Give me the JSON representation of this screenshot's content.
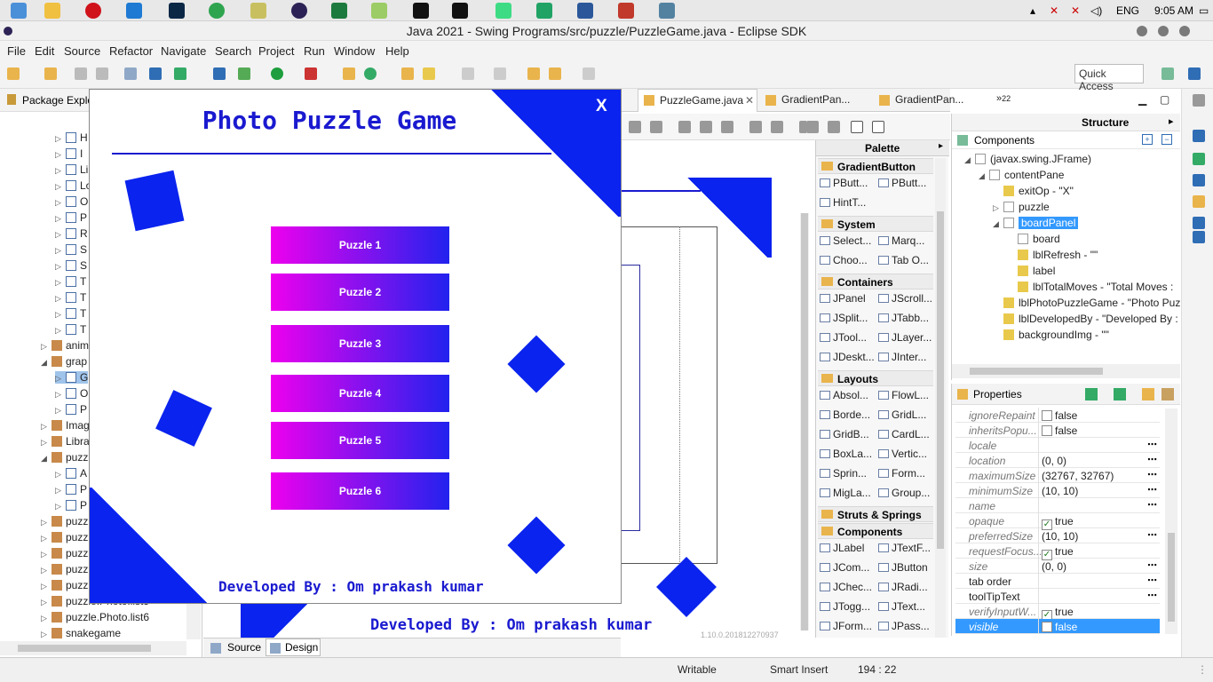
{
  "taskbar": {
    "lang": "ENG",
    "time": "9:05 AM"
  },
  "window": {
    "title": "Java 2021 - Swing Programs/src/puzzle/PuzzleGame.java - Eclipse SDK"
  },
  "menu": [
    "File",
    "Edit",
    "Source",
    "Refactor",
    "Navigate",
    "Search",
    "Project",
    "Run",
    "Window",
    "Help"
  ],
  "toolbar": {
    "quick_access": "Quick Access"
  },
  "package_explorer": {
    "title": "Package Explo",
    "items": [
      {
        "label": "H",
        "depth": 2
      },
      {
        "label": "I",
        "depth": 2
      },
      {
        "label": "Li",
        "depth": 2
      },
      {
        "label": "Lo",
        "depth": 2
      },
      {
        "label": "O",
        "depth": 2
      },
      {
        "label": "P",
        "depth": 2
      },
      {
        "label": "R",
        "depth": 2
      },
      {
        "label": "S",
        "depth": 2
      },
      {
        "label": "S",
        "depth": 2
      },
      {
        "label": "T",
        "depth": 2
      },
      {
        "label": "T",
        "depth": 2
      },
      {
        "label": "T",
        "depth": 2
      },
      {
        "label": "T",
        "depth": 2
      },
      {
        "label": "anim",
        "depth": 1
      },
      {
        "label": "grap",
        "depth": 1
      },
      {
        "label": "G",
        "depth": 2
      },
      {
        "label": "O",
        "depth": 2
      },
      {
        "label": "P",
        "depth": 2
      },
      {
        "label": "Imag",
        "depth": 1
      },
      {
        "label": "Libra",
        "depth": 1
      },
      {
        "label": "puzz",
        "depth": 1
      },
      {
        "label": "A",
        "depth": 2
      },
      {
        "label": "P",
        "depth": 2
      },
      {
        "label": "P",
        "depth": 2
      },
      {
        "label": "puzz",
        "depth": 1
      },
      {
        "label": "puzz",
        "depth": 1
      },
      {
        "label": "puzz",
        "depth": 1
      },
      {
        "label": "puzz",
        "depth": 1
      },
      {
        "label": "puzz",
        "depth": 1
      },
      {
        "label": "puzzle.Photo.list5",
        "depth": 1
      },
      {
        "label": "puzzle.Photo.list6",
        "depth": 1
      },
      {
        "label": "snakegame",
        "depth": 1
      }
    ]
  },
  "editor_tabs": [
    "PuzzleGame.java",
    "GradientPan...",
    "GradientPan...",
    "22"
  ],
  "editor": {
    "developed_by_bg": "Developed By : Om prakash kumar",
    "version_text": "1.10.0.201812270937"
  },
  "bottom_tabs": {
    "source": "Source",
    "design": "Design"
  },
  "game": {
    "title": "Photo Puzzle Game",
    "close": "X",
    "buttons": [
      "Puzzle 1",
      "Puzzle 2",
      "Puzzle 3",
      "Puzzle 4",
      "Puzzle 5",
      "Puzzle 6"
    ],
    "footer": "Developed By : Om prakash kumar",
    "colors": {
      "accent": "#0a23ee",
      "grad_start": "#ee00ee",
      "grad_end": "#2222ee"
    }
  },
  "palette": {
    "title": "Palette",
    "sections": [
      {
        "name": "GradientButton",
        "items": [
          "PButt...",
          "PButt...",
          "HintT..."
        ]
      },
      {
        "name": "System",
        "items": [
          "Select...",
          "Marq...",
          "Choo...",
          "Tab O..."
        ]
      },
      {
        "name": "Containers",
        "items": [
          "JPanel",
          "JScroll...",
          "JSplit...",
          "JTabb...",
          "JTool...",
          "JLayer...",
          "JDeskt...",
          "JInter..."
        ]
      },
      {
        "name": "Layouts",
        "items": [
          "Absol...",
          "FlowL...",
          "Borde...",
          "GridL...",
          "GridB...",
          "CardL...",
          "BoxLa...",
          "Vertic...",
          "Sprin...",
          "Form...",
          "MigLa...",
          "Group..."
        ]
      },
      {
        "name": "Struts & Springs",
        "items": []
      },
      {
        "name": "Components",
        "items": [
          "JLabel",
          "JTextF...",
          "JCom...",
          "JButton",
          "JChec...",
          "JRadi...",
          "JTogg...",
          "JText...",
          "JForm...",
          "JPass..."
        ]
      }
    ]
  },
  "structure": {
    "title": "Structure",
    "components_label": "Components",
    "tree": [
      {
        "label": "(javax.swing.JFrame)",
        "depth": 0
      },
      {
        "label": "contentPane",
        "depth": 1
      },
      {
        "label": "exitOp - \"X\"",
        "depth": 2
      },
      {
        "label": "puzzle",
        "depth": 2
      },
      {
        "label": "boardPanel",
        "depth": 2,
        "selected": true
      },
      {
        "label": "board",
        "depth": 3
      },
      {
        "label": "lblRefresh - \"\"",
        "depth": 3
      },
      {
        "label": "label",
        "depth": 3
      },
      {
        "label": "lblTotalMoves - \"Total Moves :",
        "depth": 3
      },
      {
        "label": "lblPhotoPuzzleGame - \"Photo Puz",
        "depth": 2
      },
      {
        "label": "lblDevelopedBy - \"Developed By :",
        "depth": 2
      },
      {
        "label": "backgroundImg - \"\"",
        "depth": 2
      }
    ]
  },
  "properties": {
    "title": "Properties",
    "rows": [
      {
        "name": "ignoreRepaint",
        "value": "false",
        "check": "off"
      },
      {
        "name": "inheritsPopu...",
        "value": "false",
        "check": "off"
      },
      {
        "name": "locale",
        "value": ""
      },
      {
        "name": "location",
        "value": "(0, 0)"
      },
      {
        "name": "maximumSize",
        "value": "(32767, 32767)"
      },
      {
        "name": "minimumSize",
        "value": "(10, 10)"
      },
      {
        "name": "name",
        "value": ""
      },
      {
        "name": "opaque",
        "value": "true",
        "check": "on"
      },
      {
        "name": "preferredSize",
        "value": "(10, 10)"
      },
      {
        "name": "requestFocus...",
        "value": "true",
        "check": "on"
      },
      {
        "name": "size",
        "value": "(0, 0)"
      },
      {
        "name": "tab order",
        "value": ""
      },
      {
        "name": "toolTipText",
        "value": ""
      },
      {
        "name": "verifyInputW...",
        "value": "true",
        "check": "on"
      },
      {
        "name": "visible",
        "value": "false",
        "check": "off",
        "selected": true
      }
    ]
  },
  "status": {
    "writable": "Writable",
    "insert": "Smart Insert",
    "position": "194 : 22"
  }
}
